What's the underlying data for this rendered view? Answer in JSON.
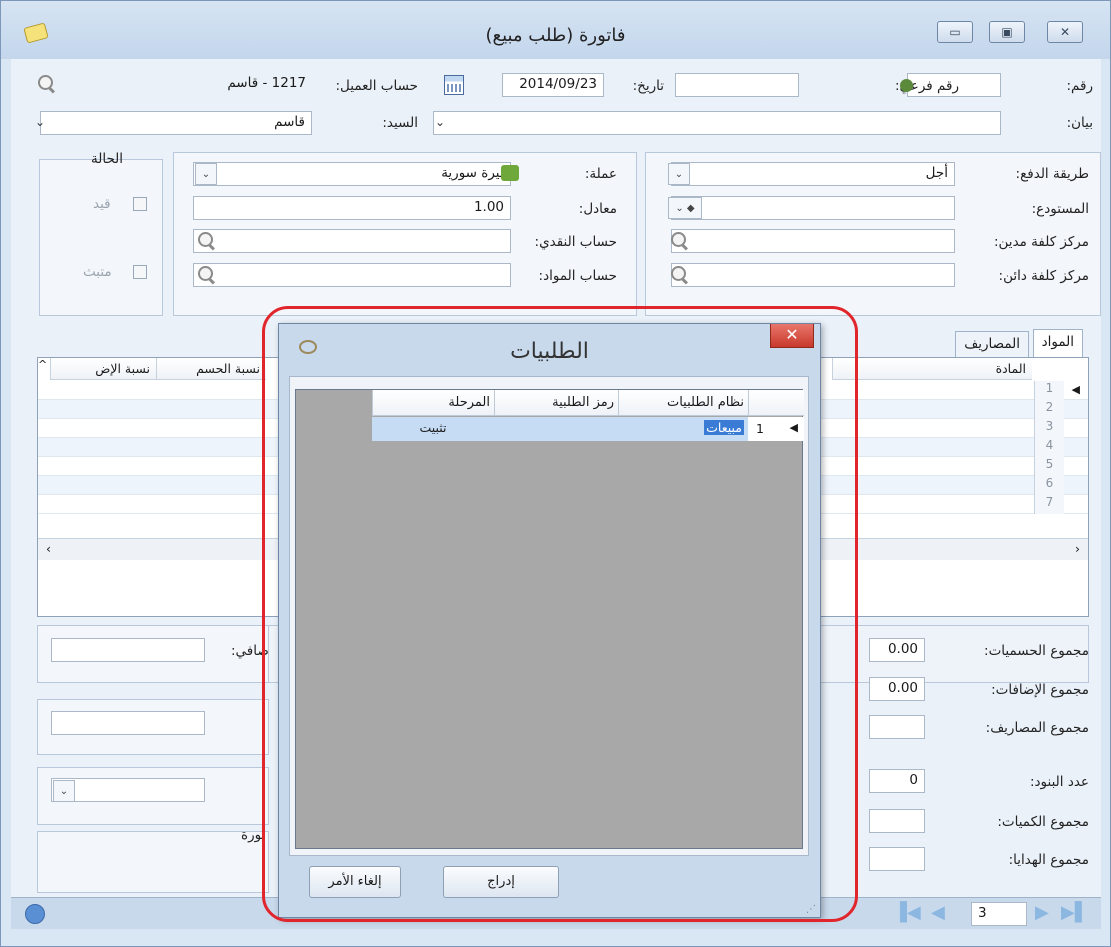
{
  "window": {
    "title": "فاتورة (طلب مبيع)",
    "min_icon": "minimize-icon",
    "max_icon": "maximize-icon",
    "close_icon": "close-icon"
  },
  "header": {
    "number_label": "رقم:",
    "sub_number_label": "رقم فرعي:",
    "date_label": "تاريخ:",
    "date_value": "2014/09/23",
    "customer_account_label": "حساب العميل:",
    "customer_account_value": "1217 - قاسم",
    "statement_label": "بيان:",
    "mister_label": "السيد:",
    "mister_value": "قاسم"
  },
  "form": {
    "payment_method_label": "طريقة الدفع:",
    "payment_method_value": "أجل",
    "warehouse_label": "المستودع:",
    "debit_cost_center_label": "مركز كلفة مدين:",
    "credit_cost_center_label": "مركز كلفة دائن:",
    "currency_label": "عملة:",
    "currency_value": "ليرة سورية",
    "rate_label": "معادل:",
    "rate_value": "1.00",
    "cash_account_label": "حساب النقدي:",
    "materials_account_label": "حساب المواد:"
  },
  "status": {
    "title": "الحالة",
    "posted_label": "قيد",
    "confirmed_label": "متبث"
  },
  "tabs": [
    {
      "label": "المواد"
    },
    {
      "label": "المصاريف"
    }
  ],
  "grid": {
    "col_material": "المادة",
    "col_discount_pct": "نسبة الحسم",
    "col_addition_pct": "نسبة الإض",
    "row_numbers": [
      "1",
      "2",
      "3",
      "4",
      "5",
      "6",
      "7"
    ]
  },
  "totals": {
    "discounts_label": "مجموع الحسميات:",
    "discounts_value": "0.00",
    "additions_label": "مجموع الإضافات:",
    "additions_value": "0.00",
    "expenses_label": "مجموع المصاريف:",
    "items_count_label": "عدد البنود:",
    "items_count_value": "0",
    "quantities_label": "مجموع الكميات:",
    "gifts_label": "مجموع الهدايا:",
    "net_label_fragment": "صافي:",
    "invoice_fragment": "تورة"
  },
  "nav": {
    "page_value": "3"
  },
  "dialog": {
    "title": "الطلبيات",
    "columns": [
      "نظام الطلبيات",
      "رمز الطلبية",
      "المرحلة"
    ],
    "rows": [
      {
        "num": "1",
        "system": "مبيعات",
        "code": "",
        "stage": "تثبيت"
      }
    ],
    "insert_label": "إدراج",
    "cancel_label": "إلغاء الأمر"
  },
  "colors": {
    "highlight": "#e1252c",
    "selection": "#c6dcf5",
    "title_bg": "#c3d6ec"
  }
}
